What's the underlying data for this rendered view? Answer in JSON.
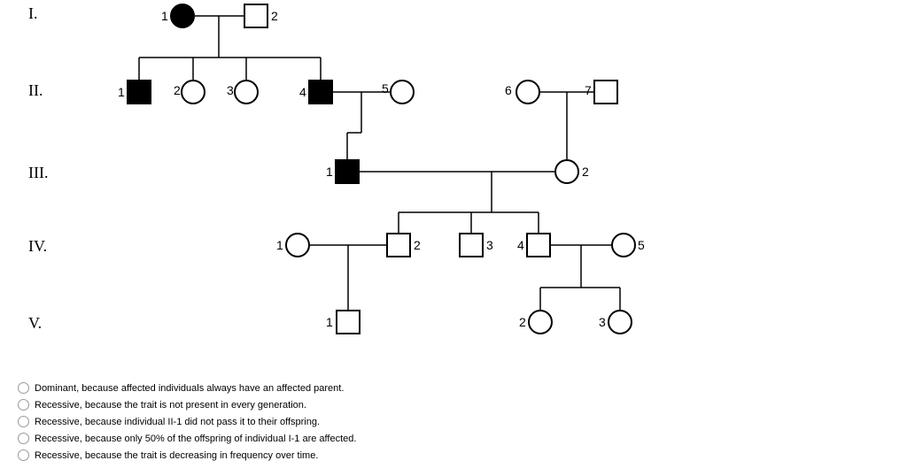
{
  "generations": {
    "I": "I.",
    "II": "II.",
    "III": "III.",
    "IV": "IV.",
    "V": "V."
  },
  "people": {
    "I1": "1",
    "I2": "2",
    "II1": "1",
    "II2": "2",
    "II3": "3",
    "II4": "4",
    "II5": "5",
    "II6": "6",
    "II7": "7",
    "III1": "1",
    "III2": "2",
    "IV1": "1",
    "IV2": "2",
    "IV3": "3",
    "IV4": "4",
    "IV5": "5",
    "V1": "1",
    "V2": "2",
    "V3": "3"
  },
  "options": [
    "Dominant, because affected individuals always have an affected parent.",
    "Recessive, because the trait is not present in every generation.",
    "Recessive, because individual II-1 did not pass it to their offspring.",
    "Recessive, because only 50% of the offspring of individual I-1 are affected.",
    "Recessive, because the trait is decreasing in frequency over time."
  ]
}
